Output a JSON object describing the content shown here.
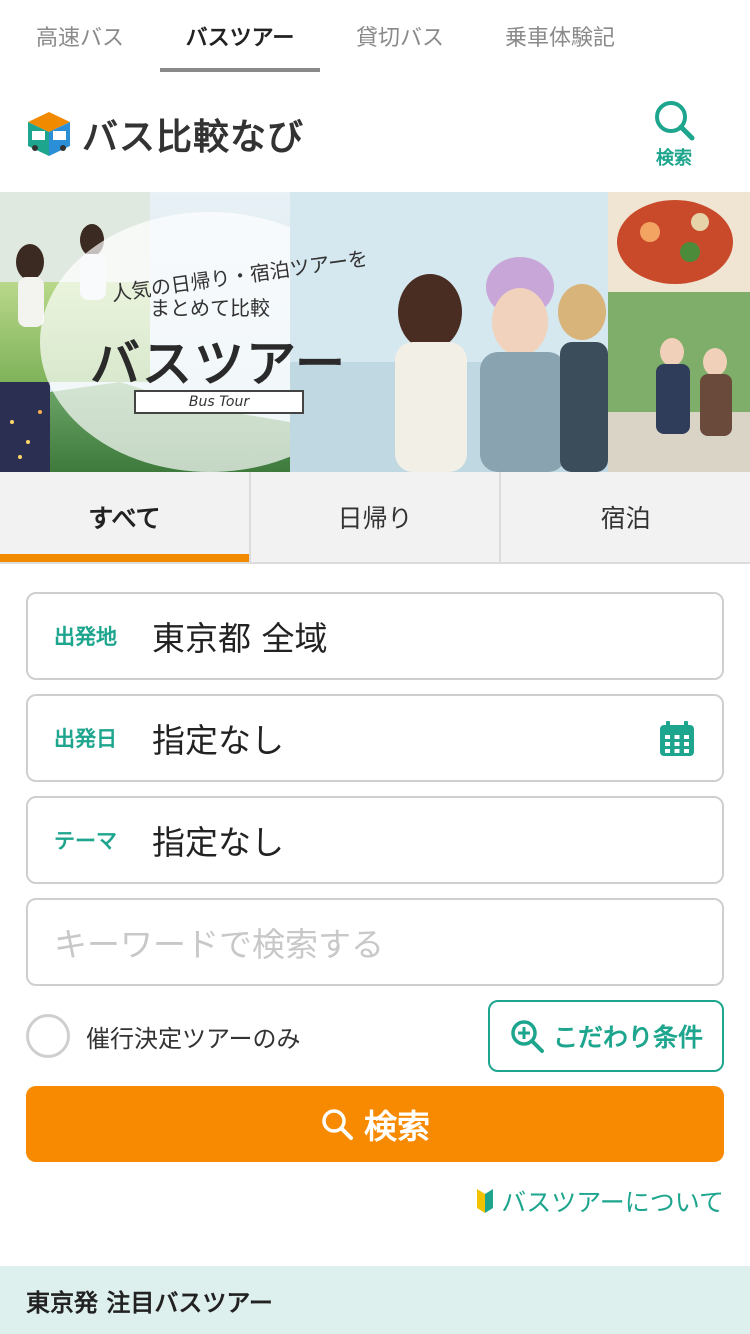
{
  "topnav": {
    "tabs": [
      {
        "label": "高速バス",
        "active": false
      },
      {
        "label": "バスツアー",
        "active": true
      },
      {
        "label": "貸切バス",
        "active": false
      },
      {
        "label": "乗車体験記",
        "active": false
      }
    ]
  },
  "header": {
    "logo_text": "バス比較なび",
    "search_label": "検索"
  },
  "hero": {
    "sub1": "人気の日帰り・宿泊ツアーを",
    "sub2": "まとめて比較",
    "title": "バスツアー",
    "ribbon": "Bus Tour"
  },
  "segments": [
    {
      "label": "すべて",
      "active": true
    },
    {
      "label": "日帰り",
      "active": false
    },
    {
      "label": "宿泊",
      "active": false
    }
  ],
  "form": {
    "departure_place": {
      "label": "出発地",
      "value": "東京都 全域"
    },
    "departure_date": {
      "label": "出発日",
      "value": "指定なし"
    },
    "theme": {
      "label": "テーマ",
      "value": "指定なし"
    },
    "keyword": {
      "placeholder": "キーワードで検索する"
    },
    "guaranteed_only": {
      "label": "催行決定ツアーのみ",
      "checked": false
    },
    "kodawari_label": "こだわり条件",
    "search_label": "検索",
    "about_label": "バスツアーについて"
  },
  "section": {
    "title": "東京発 注目バスツアー"
  },
  "colors": {
    "accent_teal": "#1ea58e",
    "accent_orange": "#f78a00"
  }
}
